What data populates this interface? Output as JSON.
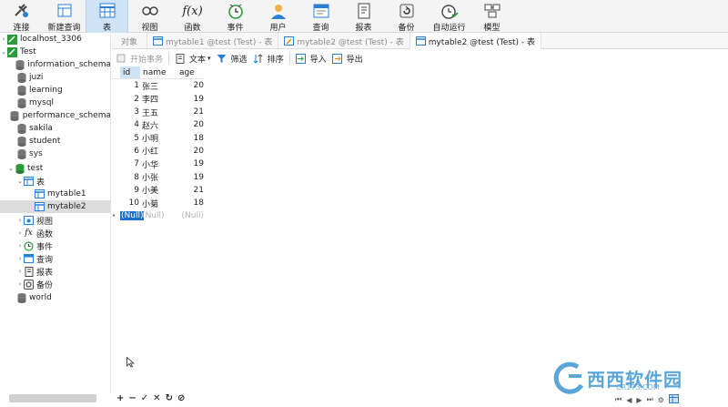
{
  "toolbar": {
    "buttons": [
      {
        "label": "连接",
        "icon": "plug-icon"
      },
      {
        "label": "新建查询",
        "icon": "new-query-icon"
      },
      {
        "label": "表",
        "icon": "table-icon"
      },
      {
        "label": "视图",
        "icon": "view-icon"
      },
      {
        "label": "函数",
        "icon": "function-icon"
      },
      {
        "label": "事件",
        "icon": "event-icon"
      },
      {
        "label": "用户",
        "icon": "user-icon"
      },
      {
        "label": "查询",
        "icon": "query-icon"
      },
      {
        "label": "报表",
        "icon": "report-icon"
      },
      {
        "label": "备份",
        "icon": "backup-icon"
      },
      {
        "label": "自动运行",
        "icon": "autorun-icon"
      },
      {
        "label": "模型",
        "icon": "model-icon"
      }
    ],
    "function_glyph": "f(x)"
  },
  "tree": {
    "conn1": "localhost_3306",
    "conn2": "Test",
    "db1": "information_schema",
    "db2": "juzi",
    "db3": "learning",
    "db4": "mysql",
    "db5": "performance_schema",
    "db6": "sakila",
    "db7": "student",
    "db8": "sys",
    "db9": "test",
    "tables_folder": "表",
    "table1": "mytable1",
    "table2": "mytable2",
    "views": "视图",
    "functions": "函数",
    "events": "事件",
    "queries": "查询",
    "reports": "报表",
    "backups": "备份",
    "db10": "world",
    "fx_glyph": "fx"
  },
  "tree_actions": [
    "+",
    "−",
    "✓",
    "✕",
    "↻",
    "⊘"
  ],
  "tabs": {
    "objects": "对象",
    "tab1": "mytable1 @test (Test) - 表",
    "tab2": "mytable2 @test (Test) - 表",
    "tab3": "mytable2 @test (Test) - 表"
  },
  "subbar": {
    "begin_tx": "开始事务",
    "text": "文本",
    "filter": "筛选",
    "sort": "排序",
    "import": "导入",
    "export": "导出"
  },
  "grid": {
    "columns": [
      "id",
      "name",
      "age"
    ],
    "rows": [
      [
        "1",
        "张三",
        "20"
      ],
      [
        "2",
        "李四",
        "19"
      ],
      [
        "3",
        "王五",
        "21"
      ],
      [
        "4",
        "赵六",
        "20"
      ],
      [
        "5",
        "小明",
        "18"
      ],
      [
        "6",
        "小红",
        "20"
      ],
      [
        "7",
        "小华",
        "19"
      ],
      [
        "8",
        "小张",
        "19"
      ],
      [
        "9",
        "小美",
        "21"
      ],
      [
        "10",
        "小菊",
        "18"
      ]
    ],
    "null_label": "(Null)",
    "new_row_marker": "•"
  },
  "watermark": {
    "brand": "西西软件园",
    "url": "CR173.COM"
  },
  "colors": {
    "accent": "#1d6fd1",
    "active_tab": "#cfe3f6",
    "db_icon": "#555555",
    "db_active": "#27a844"
  }
}
